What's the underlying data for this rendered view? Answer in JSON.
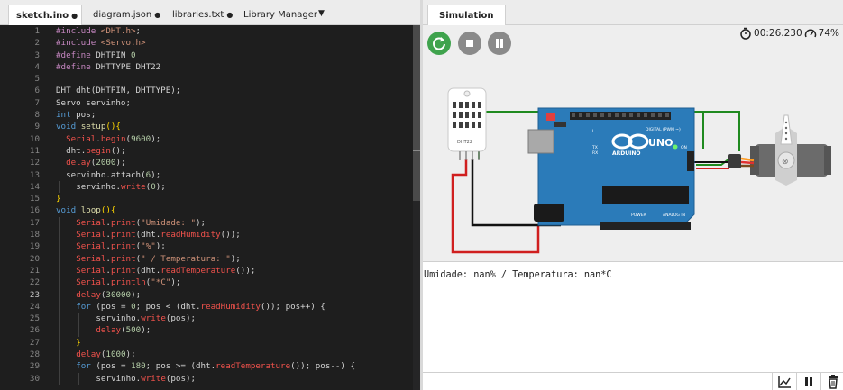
{
  "editor": {
    "tabs": [
      {
        "label": "sketch.ino",
        "modified": "●"
      },
      {
        "label": "diagram.json",
        "modified": "●"
      },
      {
        "label": "libraries.txt",
        "modified": "●"
      },
      {
        "label": "Library Manager"
      }
    ],
    "dropdown_icon": "caret-down-icon",
    "current_line": 23,
    "lines": [
      {
        "n": "1",
        "indent": 0,
        "t": [
          [
            "#include ",
            "pre"
          ],
          [
            "<DHT.h>",
            "str"
          ],
          [
            ";",
            "var"
          ]
        ]
      },
      {
        "n": "2",
        "indent": 0,
        "t": [
          [
            "#include ",
            "pre"
          ],
          [
            "<Servo.h>",
            "str"
          ]
        ]
      },
      {
        "n": "3",
        "indent": 0,
        "t": [
          [
            "#define ",
            "pre"
          ],
          [
            "DHTPIN ",
            "var"
          ],
          [
            "0",
            "num"
          ]
        ]
      },
      {
        "n": "4",
        "indent": 0,
        "t": [
          [
            "#define ",
            "pre"
          ],
          [
            "DHTTYPE DHT22",
            "var"
          ]
        ]
      },
      {
        "n": "5",
        "indent": 0,
        "t": []
      },
      {
        "n": "6",
        "indent": 0,
        "t": [
          [
            "DHT dht(DHTPIN, DHTTYPE);",
            "var"
          ]
        ]
      },
      {
        "n": "7",
        "indent": 0,
        "t": [
          [
            "Servo servinho;",
            "var"
          ]
        ]
      },
      {
        "n": "8",
        "indent": 0,
        "t": [
          [
            "int",
            "kw"
          ],
          [
            " pos;",
            "var"
          ]
        ]
      },
      {
        "n": "9",
        "indent": 0,
        "t": [
          [
            "void",
            "kw"
          ],
          [
            " ",
            "var"
          ],
          [
            "setup",
            "fn"
          ],
          [
            "(){",
            "br"
          ]
        ]
      },
      {
        "n": "10",
        "indent": 1,
        "t": [
          [
            "Serial",
            "ser"
          ],
          [
            ".",
            "var"
          ],
          [
            "begin",
            "ser"
          ],
          [
            "(",
            "var"
          ],
          [
            "9600",
            "num"
          ],
          [
            ");",
            "var"
          ]
        ]
      },
      {
        "n": "11",
        "indent": 1,
        "t": [
          [
            "dht.",
            "var"
          ],
          [
            "begin",
            "ser"
          ],
          [
            "();",
            "var"
          ]
        ]
      },
      {
        "n": "12",
        "indent": 1,
        "t": [
          [
            "delay",
            "ser"
          ],
          [
            "(",
            "var"
          ],
          [
            "2000",
            "num"
          ],
          [
            ");",
            "var"
          ]
        ]
      },
      {
        "n": "13",
        "indent": 1,
        "t": [
          [
            "servinho.attach(",
            "var"
          ],
          [
            "6",
            "num"
          ],
          [
            ");",
            "var"
          ]
        ]
      },
      {
        "n": "14",
        "indent": 2,
        "t": [
          [
            "servinho.",
            "var"
          ],
          [
            "write",
            "ser"
          ],
          [
            "(",
            "var"
          ],
          [
            "0",
            "num"
          ],
          [
            ");",
            "var"
          ]
        ]
      },
      {
        "n": "15",
        "indent": 0,
        "t": [
          [
            "}",
            "br"
          ]
        ]
      },
      {
        "n": "16",
        "indent": 0,
        "t": [
          [
            "void",
            "kw"
          ],
          [
            " ",
            "var"
          ],
          [
            "loop",
            "fn"
          ],
          [
            "(){",
            "br"
          ]
        ]
      },
      {
        "n": "17",
        "indent": 2,
        "t": [
          [
            "Serial",
            "ser"
          ],
          [
            ".",
            "var"
          ],
          [
            "print",
            "ser"
          ],
          [
            "(",
            "var"
          ],
          [
            "\"Umidade: \"",
            "str"
          ],
          [
            ");",
            "var"
          ]
        ]
      },
      {
        "n": "18",
        "indent": 2,
        "t": [
          [
            "Serial",
            "ser"
          ],
          [
            ".",
            "var"
          ],
          [
            "print",
            "ser"
          ],
          [
            "(dht.",
            "var"
          ],
          [
            "readHumidity",
            "ser"
          ],
          [
            "());",
            "var"
          ]
        ]
      },
      {
        "n": "19",
        "indent": 2,
        "t": [
          [
            "Serial",
            "ser"
          ],
          [
            ".",
            "var"
          ],
          [
            "print",
            "ser"
          ],
          [
            "(",
            "var"
          ],
          [
            "\"%\"",
            "str"
          ],
          [
            ");",
            "var"
          ]
        ]
      },
      {
        "n": "20",
        "indent": 2,
        "t": [
          [
            "Serial",
            "ser"
          ],
          [
            ".",
            "var"
          ],
          [
            "print",
            "ser"
          ],
          [
            "(",
            "var"
          ],
          [
            "\" / Temperatura: \"",
            "str"
          ],
          [
            ");",
            "var"
          ]
        ]
      },
      {
        "n": "21",
        "indent": 2,
        "t": [
          [
            "Serial",
            "ser"
          ],
          [
            ".",
            "var"
          ],
          [
            "print",
            "ser"
          ],
          [
            "(dht.",
            "var"
          ],
          [
            "readTemperature",
            "ser"
          ],
          [
            "());",
            "var"
          ]
        ]
      },
      {
        "n": "22",
        "indent": 2,
        "t": [
          [
            "Serial",
            "ser"
          ],
          [
            ".",
            "var"
          ],
          [
            "println",
            "ser"
          ],
          [
            "(",
            "var"
          ],
          [
            "\"*C\"",
            "str"
          ],
          [
            ");",
            "var"
          ]
        ]
      },
      {
        "n": "23",
        "indent": 2,
        "t": [
          [
            "delay",
            "ser"
          ],
          [
            "(",
            "var"
          ],
          [
            "30000",
            "num"
          ],
          [
            ");",
            "var"
          ]
        ]
      },
      {
        "n": "24",
        "indent": 2,
        "t": [
          [
            "for",
            "kw"
          ],
          [
            " (pos = ",
            "var"
          ],
          [
            "0",
            "num"
          ],
          [
            "; pos < (dht.",
            "var"
          ],
          [
            "readHumidity",
            "ser"
          ],
          [
            "()); pos++) {",
            "var"
          ]
        ]
      },
      {
        "n": "25",
        "indent": 4,
        "t": [
          [
            "servinho.",
            "var"
          ],
          [
            "write",
            "ser"
          ],
          [
            "(pos);",
            "var"
          ]
        ]
      },
      {
        "n": "26",
        "indent": 4,
        "t": [
          [
            "delay",
            "ser"
          ],
          [
            "(",
            "var"
          ],
          [
            "500",
            "num"
          ],
          [
            ");",
            "var"
          ]
        ]
      },
      {
        "n": "27",
        "indent": 2,
        "t": [
          [
            "}",
            "br"
          ]
        ]
      },
      {
        "n": "28",
        "indent": 2,
        "t": [
          [
            "delay",
            "ser"
          ],
          [
            "(",
            "var"
          ],
          [
            "1000",
            "num"
          ],
          [
            ");",
            "var"
          ]
        ]
      },
      {
        "n": "29",
        "indent": 2,
        "t": [
          [
            "for",
            "kw"
          ],
          [
            " (pos = ",
            "var"
          ],
          [
            "180",
            "num"
          ],
          [
            "; pos >= (dht.",
            "var"
          ],
          [
            "readTemperature",
            "ser"
          ],
          [
            "()); pos--) {",
            "var"
          ]
        ]
      },
      {
        "n": "30",
        "indent": 4,
        "t": [
          [
            "servinho.",
            "var"
          ],
          [
            "write",
            "ser"
          ],
          [
            "(pos);",
            "var"
          ]
        ]
      }
    ]
  },
  "simulation": {
    "tab_label": "Simulation",
    "elapsed": "00:26.230",
    "speed": "74%",
    "buttons": {
      "restart": "restart-icon",
      "stop": "stop-icon",
      "pause": "pause-icon"
    },
    "board": {
      "brand": "ARDUINO",
      "model": "UNO",
      "digital_label": "DIGITAL (PWM ~)",
      "analog_label": "ANALOG IN",
      "power_label": "POWER",
      "tx_label": "TX",
      "rx_label": "RX",
      "on_label": "ON",
      "l_label": "L"
    },
    "sensor_label": "DHT22",
    "colors": {
      "restart": "#3fa34d",
      "board": "#2b7bb9",
      "wire_green": "#1f8a1f",
      "wire_red": "#d01f1f",
      "wire_black": "#111111"
    }
  },
  "serial": {
    "output": "Umidade: nan% / Temperatura: nan*C",
    "toolbar": {
      "plotter": "chart-icon",
      "pause": "pause-icon",
      "clear": "trash-icon"
    }
  }
}
